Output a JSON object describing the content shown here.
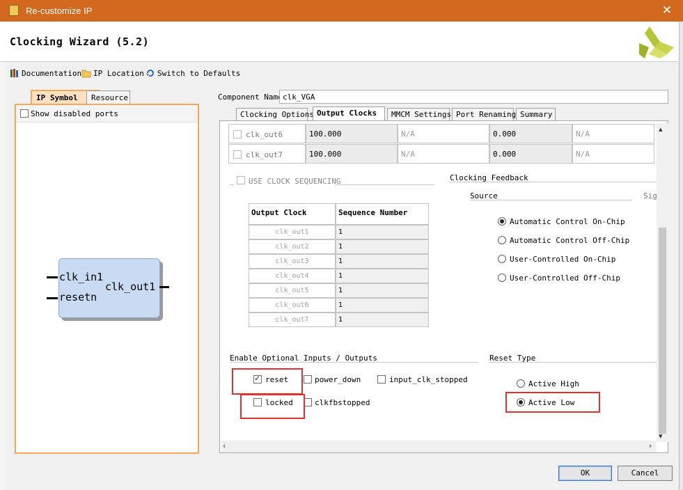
{
  "window": {
    "title": "Re-customize IP",
    "close_glyph": "✕"
  },
  "header": {
    "title": "Clocking Wizard (5.2)"
  },
  "toolbar": {
    "documentation": "Documentation",
    "ip_location": "IP Location",
    "switch_defaults": "Switch to Defaults"
  },
  "left": {
    "tabs": [
      "IP Symbol",
      "Resource"
    ],
    "show_disabled_ports": "Show disabled ports",
    "ports_in": [
      "clk_in1",
      "resetn"
    ],
    "ports_out": [
      "clk_out1"
    ]
  },
  "component": {
    "label": "Component Name",
    "value": "clk_VGA"
  },
  "tabs": [
    "Clocking Options",
    "Output Clocks",
    "MMCM Settings",
    "Port Renaming",
    "Summary"
  ],
  "output_rows": [
    {
      "name": "clk_out6",
      "freq": "100.000",
      "actual": "N/A",
      "phase": "0.000",
      "actual_phase": "N/A"
    },
    {
      "name": "clk_out7",
      "freq": "100.000",
      "actual": "N/A",
      "phase": "0.000",
      "actual_phase": "N/A"
    }
  ],
  "sequencing": {
    "label": "USE CLOCK SEQUENCING",
    "headers": [
      "Output Clock",
      "Sequence Number"
    ],
    "rows": [
      {
        "clock": "clk_out1",
        "seq": "1"
      },
      {
        "clock": "clk_out2",
        "seq": "1"
      },
      {
        "clock": "clk_out3",
        "seq": "1"
      },
      {
        "clock": "clk_out4",
        "seq": "1"
      },
      {
        "clock": "clk_out5",
        "seq": "1"
      },
      {
        "clock": "clk_out6",
        "seq": "1"
      },
      {
        "clock": "clk_out7",
        "seq": "1"
      }
    ]
  },
  "feedback": {
    "title": "Clocking Feedback",
    "source_label": "Source",
    "signal_label": "Sig",
    "options": [
      "Automatic Control On-Chip",
      "Automatic Control Off-Chip",
      "User-Controlled On-Chip",
      "User-Controlled Off-Chip"
    ],
    "selected": "Automatic Control On-Chip"
  },
  "optional_io": {
    "title": "Enable Optional Inputs / Outputs",
    "reset": "reset",
    "power_down": "power_down",
    "input_clk_stopped": "input_clk_stopped",
    "locked": "locked",
    "clkfbstopped": "clkfbstopped",
    "checked": [
      "reset"
    ]
  },
  "reset_type": {
    "title": "Reset Type",
    "options": [
      "Active High",
      "Active Low"
    ],
    "selected": "Active Low"
  },
  "buttons": {
    "ok": "OK",
    "cancel": "Cancel"
  },
  "colors": {
    "titlebar": "#d2691e",
    "highlight": "#e03030",
    "panel_border": "#f5a75a"
  }
}
